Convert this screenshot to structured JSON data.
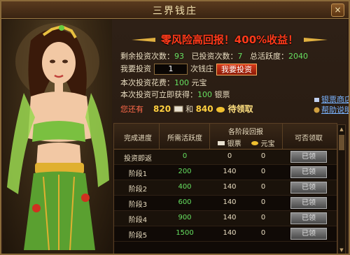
{
  "window": {
    "title": "三界钱庄",
    "close": "×"
  },
  "banner": "零风险高回报！400%收益！",
  "stats": {
    "remaining_label": "剩余投资次数：",
    "remaining": "93",
    "invested_label": "已投资次数：",
    "invested": "7",
    "total_label": "总活跃度：",
    "total": "2040"
  },
  "invest": {
    "label": "我要投资",
    "value": "1",
    "unit": "次钱庄",
    "button": "我要投资"
  },
  "cost": {
    "label": "本次投资花费：",
    "value": "100",
    "unit": "元宝"
  },
  "gain": {
    "label": "本次投资可立即获得：",
    "value": "100",
    "unit": "银票"
  },
  "owned": {
    "label": "您还有",
    "a": "820",
    "and": "和",
    "b": "840",
    "pending": "待领取"
  },
  "links": {
    "shop": "银票商店",
    "help": "帮助说明"
  },
  "table": {
    "headers": {
      "progress": "完成进度",
      "activity": "所需活跃度",
      "returns": "各阶段回报",
      "yinpiao": "银票",
      "yuanbao": "元宝",
      "claim": "可否领取"
    },
    "rows": [
      {
        "stage": "投资即返",
        "activity": "0",
        "yinpiao": "0",
        "yuanbao": "0",
        "claim": "已领"
      },
      {
        "stage": "阶段1",
        "activity": "200",
        "yinpiao": "140",
        "yuanbao": "0",
        "claim": "已领"
      },
      {
        "stage": "阶段2",
        "activity": "400",
        "yinpiao": "140",
        "yuanbao": "0",
        "claim": "已领"
      },
      {
        "stage": "阶段3",
        "activity": "600",
        "yinpiao": "140",
        "yuanbao": "0",
        "claim": "已领"
      },
      {
        "stage": "阶段4",
        "activity": "900",
        "yinpiao": "140",
        "yuanbao": "0",
        "claim": "已领"
      },
      {
        "stage": "阶段5",
        "activity": "1500",
        "yinpiao": "140",
        "yuanbao": "0",
        "claim": "已领"
      }
    ]
  },
  "colors": {
    "accent_red": "#ff3a1a",
    "green": "#66e060",
    "gold": "#ffd040"
  }
}
